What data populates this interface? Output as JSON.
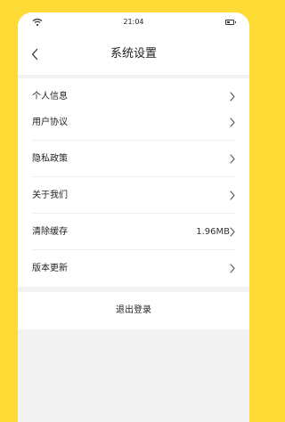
{
  "status_bar": {
    "time": "21:04",
    "wifi_icon": "wifi-icon",
    "battery_icon": "battery-icon"
  },
  "header": {
    "title": "系统设置",
    "back_icon": "chevron-left-icon"
  },
  "groups": [
    {
      "items": [
        {
          "label": "个人信息"
        }
      ]
    },
    {
      "items": [
        {
          "label": "用户协议"
        },
        {
          "label": "隐私政策"
        },
        {
          "label": "关于我们"
        },
        {
          "label": "清除缓存",
          "value": "1.96MB"
        },
        {
          "label": "版本更新"
        }
      ]
    }
  ],
  "logout": {
    "label": "退出登录"
  },
  "colors": {
    "background": "#FEDB35",
    "surface": "#FFFFFF",
    "page": "#F2F2F2",
    "text": "#222222",
    "chevron": "#555555"
  }
}
